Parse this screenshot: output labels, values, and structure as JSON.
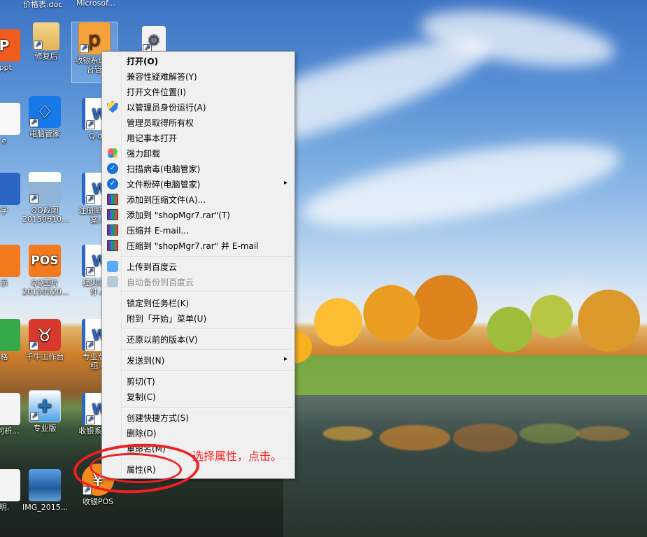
{
  "desktop": {
    "top_labels": [
      "价格表.doc",
      "Microsof..."
    ],
    "icons": [
      {
        "label": ".ppt"
      },
      {
        "label": "修复后"
      },
      {
        "label": "收银系统后台管"
      },
      {
        "label": ""
      },
      {
        "label": "e"
      },
      {
        "label": "电脑管家"
      },
      {
        "label": "Q.do"
      },
      {
        "label": "字"
      },
      {
        "label": "QQ截图20150610..."
      },
      {
        "label": "注册邮箱方案.d"
      },
      {
        "label": "示"
      },
      {
        "label": "QQ图片20150520..."
      },
      {
        "label": "经典收银件.d"
      },
      {
        "label": "格"
      },
      {
        "label": "千牛工作台"
      },
      {
        "label": "专业版软绍.d"
      },
      {
        "label": "如何析..."
      },
      {
        "label": "专业版"
      },
      {
        "label": "收银系统指"
      },
      {
        "label": "明."
      },
      {
        "label": "IMG_2015..."
      },
      {
        "label": "收银POS"
      }
    ]
  },
  "context_menu": {
    "items": [
      {
        "label": "打开(O)",
        "bold": true,
        "icon": ""
      },
      {
        "label": "兼容性疑难解答(Y)",
        "icon": ""
      },
      {
        "label": "打开文件位置(I)",
        "icon": ""
      },
      {
        "label": "以管理员身份运行(A)",
        "icon": "shield-icon"
      },
      {
        "label": "管理员取得所有权",
        "icon": ""
      },
      {
        "label": "用记事本打开",
        "icon": ""
      },
      {
        "label": "强力卸载",
        "icon": "uninstall-flower-icon"
      },
      {
        "label": "扫描病毒(电脑管家)",
        "icon": "computer-manager-icon"
      },
      {
        "label": "文件粉碎(电脑管家)",
        "icon": "computer-manager-icon",
        "submenu": "▸"
      },
      {
        "label": "添加到压缩文件(A)...",
        "icon": "winrar-icon"
      },
      {
        "label": "添加到 \"shopMgr7.rar\"(T)",
        "icon": "winrar-icon"
      },
      {
        "label": "压缩并 E-mail...",
        "icon": "winrar-icon"
      },
      {
        "label": "压缩到 \"shopMgr7.rar\" 并 E-mail",
        "icon": "winrar-icon"
      },
      {
        "label": "上传到百度云",
        "icon": "baidu-cloud-icon"
      },
      {
        "label": "自动备份到百度云",
        "icon": "baidu-cloud-disabled-icon",
        "disabled": true
      },
      {
        "label": "锁定到任务栏(K)",
        "icon": ""
      },
      {
        "label": "附到「开始」菜单(U)",
        "icon": ""
      },
      {
        "label": "还原以前的版本(V)",
        "icon": ""
      },
      {
        "label": "发送到(N)",
        "icon": "",
        "submenu": "▸"
      },
      {
        "label": "剪切(T)",
        "icon": ""
      },
      {
        "label": "复制(C)",
        "icon": ""
      },
      {
        "label": "创建快捷方式(S)",
        "icon": ""
      },
      {
        "label": "删除(D)",
        "icon": ""
      },
      {
        "label": "重命名(M)",
        "icon": ""
      },
      {
        "label": "属性(R)",
        "icon": ""
      }
    ]
  },
  "annotation": {
    "text": "选择属性，点击。",
    "color": "#ef1f24"
  },
  "icons": {
    "shortcut": "shortcut-arrow-icon",
    "folder": "folder-icon",
    "app_p": "p-app-icon",
    "settings": "settings-icon",
    "qq_guard": "computer-manager-icon",
    "word": "word-document-icon",
    "pos": "pos-icon",
    "qianniu": "qianniu-icon",
    "tools": "tools-icon",
    "image": "image-icon",
    "red_app": "red-app-icon"
  }
}
